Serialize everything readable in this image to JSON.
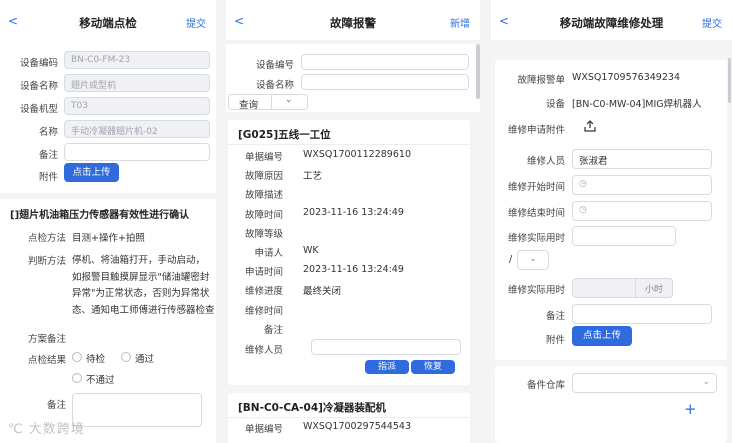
{
  "p1": {
    "back": "<",
    "title": "移动端点检",
    "submit": "提交",
    "fields": [
      {
        "label": "设备编码",
        "value": "BN-C0-FM-23"
      },
      {
        "label": "设备名称",
        "value": "翅片成型机"
      },
      {
        "label": "设备机型",
        "value": "T03"
      },
      {
        "label": "名称",
        "value": "手动冷凝器翅片机-02"
      },
      {
        "label": "备注",
        "value": ""
      }
    ],
    "attach_label": "附件",
    "upload": "点击上传",
    "check_title": "[]翅片机油箱压力传感器有效性进行确认",
    "method_label": "点检方法",
    "method_value": "目测+操作+拍照",
    "judge_label": "判断方法",
    "judge_lines": [
      "停机、将油箱打开，手动启动，",
      "如报警目触摸屏显示\"储油罐密封",
      "异常\"为正常状态，否则为异常状",
      "态、通知电工师傅进行传感器检查"
    ],
    "plan_label": "方案备注",
    "result_label": "点检结果",
    "options": [
      "待检",
      "通过",
      "不通过"
    ],
    "note_label": "备注",
    "watermark": "大数跨境"
  },
  "p2": {
    "back": "<",
    "title": "故障报警",
    "add": "新增",
    "search_fields": [
      {
        "label": "设备编号",
        "value": ""
      },
      {
        "label": "设备名称",
        "value": ""
      }
    ],
    "query": "查询",
    "card1": {
      "title": "[G025]五线一工位",
      "rows": [
        {
          "k": "单据编号",
          "v": "WXSQ1700112289610"
        },
        {
          "k": "故障原因",
          "v": "工艺"
        },
        {
          "k": "故障描述",
          "v": ""
        },
        {
          "k": "故障时间",
          "v": "2023-11-16 13:24:49"
        },
        {
          "k": "故障等级",
          "v": ""
        },
        {
          "k": "申请人",
          "v": "WK"
        },
        {
          "k": "申请时间",
          "v": "2023-11-16 13:24:49"
        },
        {
          "k": "维修进度",
          "v": "最终关闭"
        },
        {
          "k": "维修时间",
          "v": ""
        },
        {
          "k": "备注",
          "v": ""
        }
      ],
      "person_label": "维修人员",
      "assign": "指派",
      "restore": "恢复"
    },
    "card2": {
      "title": "[BN-C0-CA-04]冷凝器装配机",
      "rows": [
        {
          "k": "单据编号",
          "v": "WXSQ1700297544543"
        }
      ]
    }
  },
  "p3": {
    "back": "<",
    "title": "移动端故障维修处理",
    "submit": "提交",
    "order_label": "故障报警单",
    "order_value": "WXSQ1709576349234",
    "device_label": "设备",
    "device_value": "[BN-C0-MW-04]MIG焊机器人",
    "attach_label": "维修申请附件",
    "person_label": "维修人员",
    "person_value": "张淑君",
    "start_label": "维修开始时间",
    "end_label": "维修结束时间",
    "used_label": "维修实际用时",
    "slash": "/",
    "used2_label": "维修实际用时",
    "hours": "小时",
    "note_label": "备注",
    "attach2_label": "附件",
    "upload": "点击上传",
    "spare_label": "备件仓库",
    "plus": "+"
  }
}
